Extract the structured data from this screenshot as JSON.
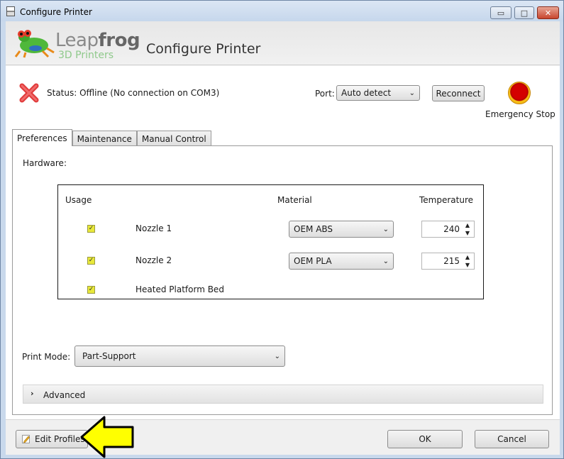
{
  "window": {
    "title": "Configure Printer",
    "controls": {
      "minimize": "▭",
      "maximize": "□",
      "close": "✕"
    }
  },
  "header": {
    "logo_brand_light": "Leap",
    "logo_brand_bold": "frog",
    "logo_sub": "3D Printers",
    "title": "Configure Printer"
  },
  "status": {
    "icon": "error-x-icon",
    "text": "Status: Offline (No connection on COM3)",
    "port_label": "Port:",
    "port_value": "Auto detect",
    "reconnect_label": "Reconnect",
    "emergency_stop_label": "Emergency Stop"
  },
  "tabs": [
    {
      "label": "Preferences",
      "active": true
    },
    {
      "label": "Maintenance",
      "active": false
    },
    {
      "label": "Manual Control",
      "active": false
    }
  ],
  "preferences": {
    "hardware_label": "Hardware:",
    "columns": {
      "usage": "Usage",
      "material": "Material",
      "temperature": "Temperature"
    },
    "rows": [
      {
        "label": "Nozzle 1",
        "checked": true,
        "material": "OEM ABS",
        "temperature": "240"
      },
      {
        "label": "Nozzle 2",
        "checked": true,
        "material": "OEM PLA",
        "temperature": "215"
      },
      {
        "label": "Heated Platform Bed",
        "checked": true
      }
    ],
    "print_mode_label": "Print Mode:",
    "print_mode_value": "Part-Support",
    "advanced_label": "Advanced"
  },
  "footer": {
    "edit_profiles_label": "Edit Profiles",
    "ok_label": "OK",
    "cancel_label": "Cancel"
  },
  "colors": {
    "window_frame": "#c9d9ec",
    "estop_red": "#d40000",
    "estop_ring": "#f5a800",
    "checkbox_fill": "#e8e83a",
    "annotation_arrow": "#ffff00"
  }
}
